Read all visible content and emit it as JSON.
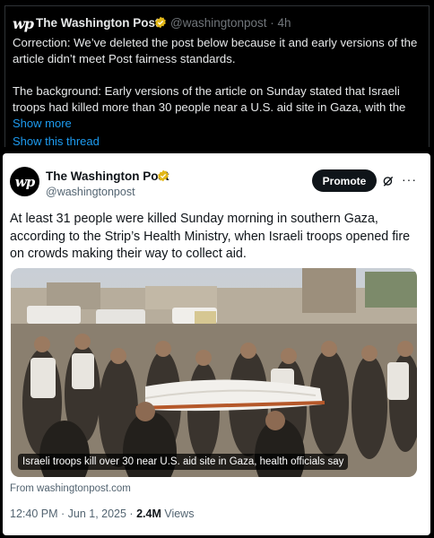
{
  "quote_post": {
    "logo_text": "wp",
    "author": "The Washington Post",
    "handle_time": "@washingtonpost · 4h",
    "correction": "Correction: We’ve deleted the post below because it and early versions of the article didn’t meet Post fairness standards.",
    "background": "The background: Early versions of the article on Sunday stated that Israeli troops had killed more than 30 people near a U.S. aid site in Gaza, with the",
    "show_more": "Show more",
    "show_thread": "Show this thread"
  },
  "embedded_post": {
    "logo_text": "wp",
    "author": "The Washington Post",
    "handle": "@washingtonpost",
    "promote_label": "Promote",
    "more_label": "···",
    "text": "At least 31 people were killed Sunday morning in southern Gaza, according to the Strip’s Health Ministry, when Israeli troops opened fire on crowds making their way to collect aid.",
    "image_caption": "Israeli troops kill over 30 near U.S. aid site in Gaza, health officials say",
    "source": "From washingtonpost.com",
    "timestamp": "12:40 PM · Jun 1, 2025 · ",
    "views_count": "2.4M",
    "views_label": " Views"
  },
  "colors": {
    "verified_badge": "#e2b719",
    "link": "#1d9bf0",
    "promote_bg": "#0f1419"
  },
  "icons": [
    "verified-badge-icon",
    "grok-icon",
    "more-icon"
  ]
}
